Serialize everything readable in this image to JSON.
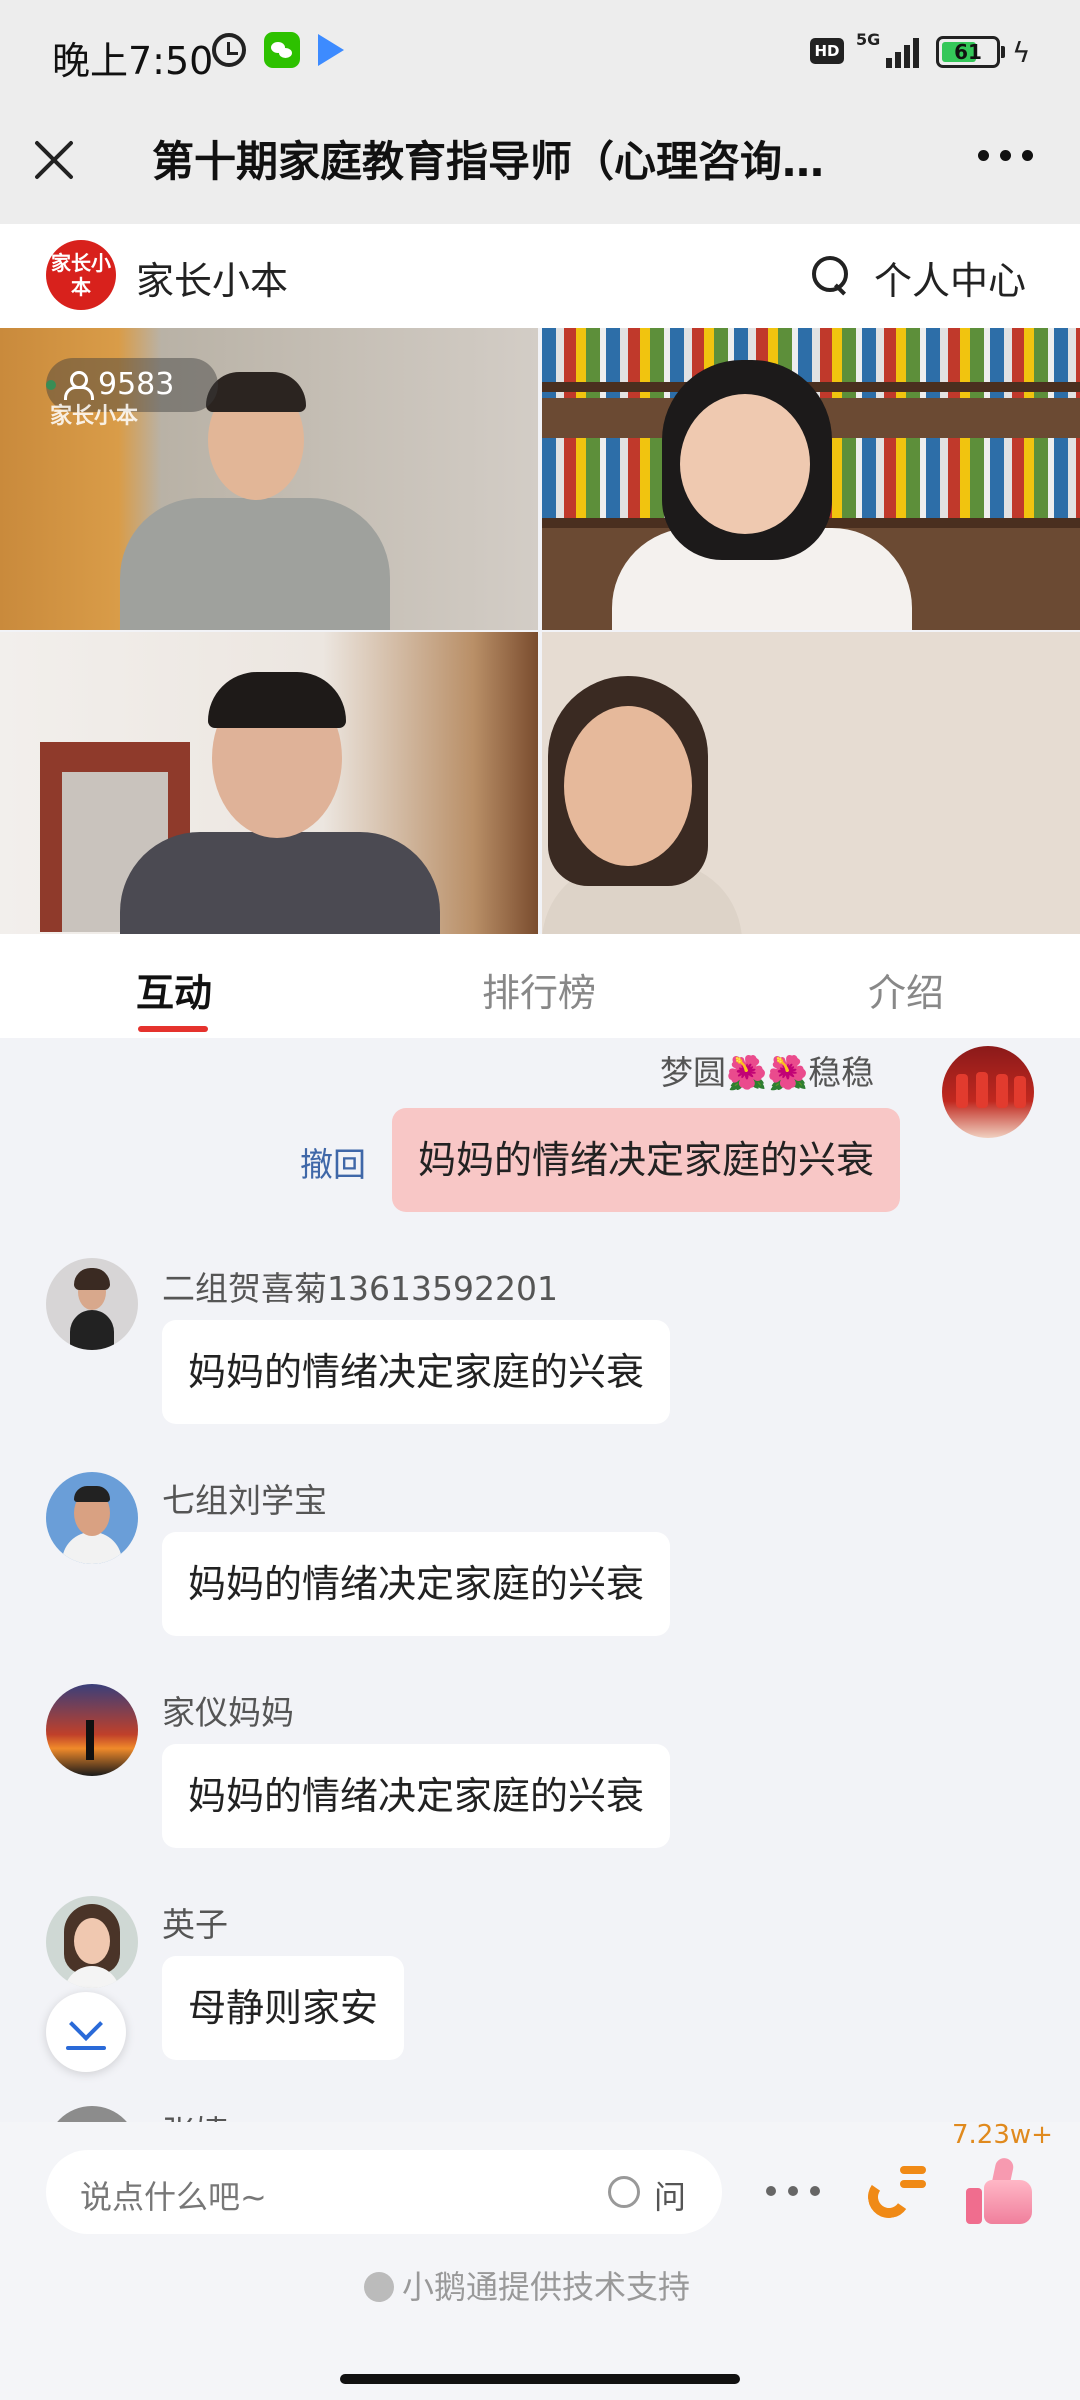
{
  "status_bar": {
    "time": "晚上7:50",
    "hd": "HD",
    "network": "5G",
    "battery": "61"
  },
  "title_bar": {
    "title": "第十期家庭教育指导师（心理咨询…"
  },
  "brand_bar": {
    "logo_text": "家长小本",
    "name": "家长小本",
    "personal_center": "个人中心"
  },
  "live": {
    "viewer_count": "9583",
    "watermark": "家长小本"
  },
  "tabs": [
    {
      "label": "互动",
      "active": true
    },
    {
      "label": "排行榜",
      "active": false
    },
    {
      "label": "介绍",
      "active": false
    }
  ],
  "chat": {
    "recall_label": "撤回",
    "messages": [
      {
        "name": "梦圆🌺🌺稳稳",
        "text": "妈妈的情绪决定家庭的兴衰",
        "mine": true
      },
      {
        "name": "二组贺喜菊13613592201",
        "text": "妈妈的情绪决定家庭的兴衰"
      },
      {
        "name": "七组刘学宝",
        "text": "妈妈的情绪决定家庭的兴衰"
      },
      {
        "name": "家仪妈妈",
        "text": "妈妈的情绪决定家庭的兴衰"
      },
      {
        "name": "英子",
        "text": "母静则家安"
      },
      {
        "name": "张婕",
        "text": ""
      }
    ]
  },
  "footer": {
    "input_placeholder": "说点什么吧~",
    "ask_label": "问",
    "likes": "7.23w+",
    "tech_support": "小鹅通提供技术支持"
  },
  "colors": {
    "accent": "#e5322d",
    "my_bubble": "#f8c7c6",
    "recall": "#3f67a8",
    "likes": "#e08a1e"
  }
}
